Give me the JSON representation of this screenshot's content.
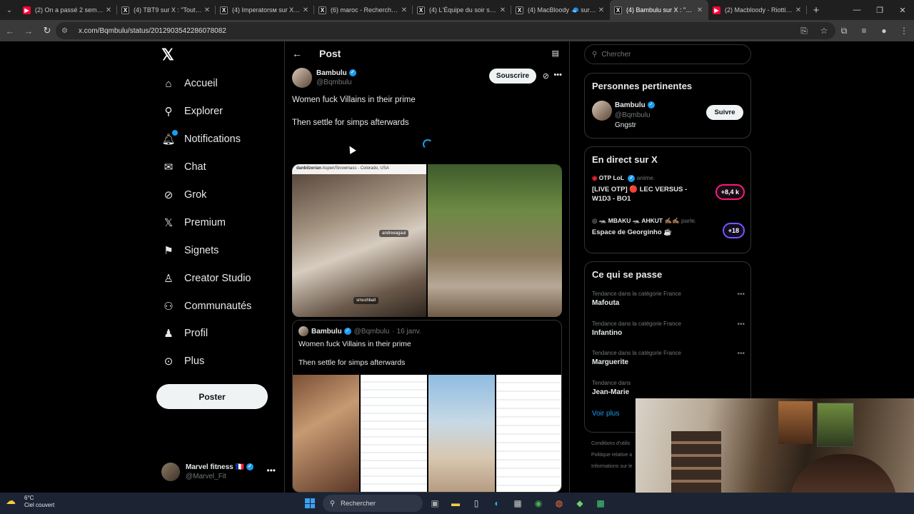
{
  "browser": {
    "tabs": [
      {
        "title": "(2) On a passé 2 semaines",
        "favicon": "youtube-icon",
        "color": "#ff0033"
      },
      {
        "title": "(4) TBT9 sur X : \"Tout le m",
        "favicon": "x-icon",
        "color": "#000000"
      },
      {
        "title": "(4) Imperatorsм sur X : \"M",
        "favicon": "x-icon",
        "color": "#000000"
      },
      {
        "title": "(6) maroc - Recherche / X",
        "favicon": "x-icon",
        "color": "#000000"
      },
      {
        "title": "(4) L'Équipe du soir sur X",
        "favicon": "x-icon",
        "color": "#000000"
      },
      {
        "title": "(4) MacBloody 🧢 sur X :",
        "favicon": "x-icon",
        "color": "#000000"
      },
      {
        "title": "(4) Bambulu sur X : \"Wom",
        "favicon": "x-icon",
        "color": "#000000",
        "active": true
      },
      {
        "title": "(2) Macbloody - Riotti (O",
        "favicon": "youtube-icon",
        "color": "#ff0033"
      }
    ],
    "url": "x.com/Bqmbulu/status/2012903542286078082"
  },
  "nav": {
    "items": [
      {
        "label": "Accueil",
        "icon": "home-icon"
      },
      {
        "label": "Explorer",
        "icon": "search-icon"
      },
      {
        "label": "Notifications",
        "icon": "bell-icon",
        "badge": true
      },
      {
        "label": "Chat",
        "icon": "mail-icon"
      },
      {
        "label": "Grok",
        "icon": "grok-icon"
      },
      {
        "label": "Premium",
        "icon": "x-logo-icon"
      },
      {
        "label": "Signets",
        "icon": "bookmark-icon"
      },
      {
        "label": "Creator Studio",
        "icon": "creator-icon"
      },
      {
        "label": "Communautés",
        "icon": "community-icon"
      },
      {
        "label": "Profil",
        "icon": "profile-icon"
      },
      {
        "label": "Plus",
        "icon": "more-circle-icon"
      }
    ],
    "post_button": "Poster",
    "account": {
      "name": "Marvel fitness 🇫🇷",
      "handle": "@Marvel_Fit"
    }
  },
  "post": {
    "header_title": "Post",
    "author_name": "Bambulu",
    "author_handle": "@Bqmbulu",
    "subscribe_label": "Souscrire",
    "text_line1": "Women fuck Villains in their prime",
    "text_line2": "Then settle for simps afterwards",
    "media_header": "danbilzerian",
    "media_location": "Aspen/Snowmass - Colorado, USA",
    "media_tag1": "andreeagaul",
    "media_tag2": "smushball",
    "quote": {
      "author_name": "Bambulu",
      "author_handle": "@Bqmbulu",
      "date": "· 16 janv.",
      "text_line1": "Women fuck Villains in their prime",
      "text_line2": "Then settle for simps afterwards"
    }
  },
  "sidebar": {
    "search_placeholder": "Chercher",
    "relevant": {
      "title": "Personnes pertinentes",
      "name": "Bambulu",
      "handle": "@Bqmbulu",
      "bio": "Gngstr",
      "follow_label": "Suivre"
    },
    "live": {
      "title": "En direct sur X",
      "items": [
        {
          "host": "OTP LoL",
          "status": "anime.",
          "title": "[LIVE OTP] 🔴 LEC VERSUS - W1D3 - BO1",
          "count": "+8,4 k"
        },
        {
          "host": "🦡 MBAKU 🦡 AHKUT ✍🏾✍🏾",
          "status": "parle.",
          "title": "Espace de Georginho ☕",
          "count": "+18"
        }
      ]
    },
    "trends": {
      "title": "Ce qui se passe",
      "items": [
        {
          "category": "Tendance dans la catégorie France",
          "name": "Mafouta"
        },
        {
          "category": "Tendance dans la catégorie France",
          "name": "Infantino"
        },
        {
          "category": "Tendance dans la catégorie France",
          "name": "Marguerite"
        },
        {
          "category": "Tendance dans",
          "name": "Jean-Marie"
        }
      ],
      "see_more": "Voir plus"
    },
    "footer": [
      "Conditions d'utilis",
      "Politique relative a",
      "Informations sur le"
    ]
  },
  "taskbar": {
    "temperature": "6°C",
    "weather": "Ciel couvert",
    "search_label": "Rechercher"
  }
}
